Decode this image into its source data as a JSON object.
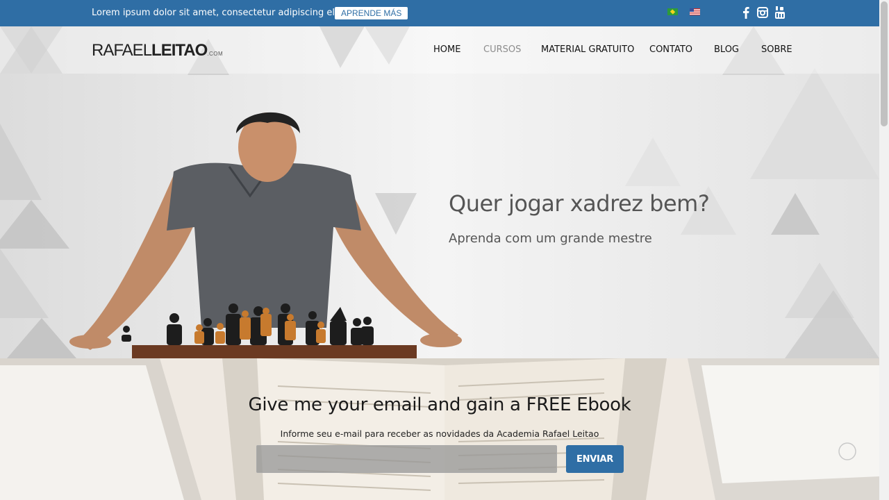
{
  "topbar": {
    "promo_text": "Lorem ipsum dolor sit amet, consectetur adipiscing elit, sed",
    "promo_button": "APRENDE MÁS",
    "flags": [
      "brazil-flag-icon",
      "us-flag-icon"
    ],
    "social": [
      "facebook-icon",
      "instagram-icon",
      "youtube-icon"
    ],
    "color": "#2f6ea5"
  },
  "header": {
    "logo": {
      "part1": "RAFAEL",
      "part2": "LEITAO",
      "suffix": ".COM"
    },
    "nav": [
      {
        "label": "HOME"
      },
      {
        "label": "CURSOS",
        "active": true
      },
      {
        "label": "MATERIAL GRATUITO"
      },
      {
        "label": "CONTATO"
      },
      {
        "label": "BLOG"
      },
      {
        "label": "SOBRE"
      }
    ]
  },
  "hero": {
    "title": "Quer jogar xadrez bem?",
    "subtitle": "Aprenda com um grande mestre"
  },
  "signup": {
    "title": "Give me your email and gain a FREE Ebook",
    "description": "Informe seu e-mail para receber as novidades da Academia Rafael Leitao",
    "input_placeholder": "",
    "button": "ENVIAR",
    "button_color": "#2f6ea5"
  }
}
